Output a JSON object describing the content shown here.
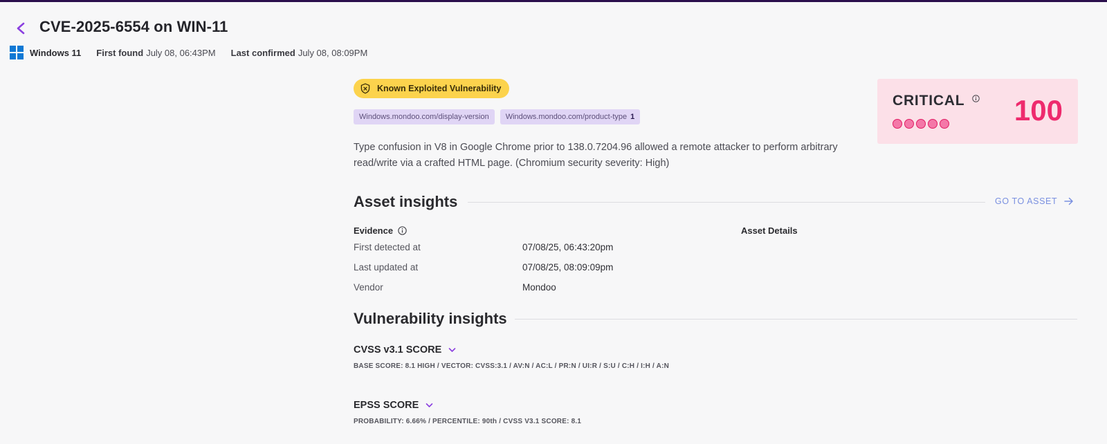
{
  "header": {
    "title": "CVE-2025-6554 on WIN-11",
    "os": "Windows 11",
    "first_found_label": "First found",
    "first_found_value": "July 08, 06:43PM",
    "last_confirmed_label": "Last confirmed",
    "last_confirmed_value": "July 08, 08:09PM"
  },
  "badge": {
    "label": "Known Exploited Vulnerability",
    "color": "#fcd34d"
  },
  "tags": [
    {
      "label": "Windows.mondoo.com/display-version",
      "count": ""
    },
    {
      "label": "Windows.mondoo.com/product-type",
      "count": "1"
    }
  ],
  "description": "Type confusion in V8 in Google Chrome prior to 138.0.7204.96 allowed a remote attacker to perform arbitrary read/write via a crafted HTML page. (Chromium security severity: High)",
  "score": {
    "severity": "CRITICAL",
    "value": "100",
    "dots": 5,
    "accent": "#ee2a6d",
    "background": "#fce0e8"
  },
  "asset_insights": {
    "title": "Asset insights",
    "go_to_asset": "GO TO ASSET",
    "evidence_label": "Evidence",
    "asset_details_label": "Asset Details",
    "rows": [
      {
        "label": "First detected at",
        "value": "07/08/25, 06:43:20pm"
      },
      {
        "label": "Last updated at",
        "value": "07/08/25, 08:09:09pm"
      },
      {
        "label": "Vendor",
        "value": "Mondoo"
      }
    ]
  },
  "vulnerability_insights": {
    "title": "Vulnerability insights",
    "cvss": {
      "label": "CVSS v3.1 SCORE",
      "detail": "BASE SCORE: 8.1 HIGH / VECTOR: CVSS:3.1 / AV:N / AC:L / PR:N / UI:R / S:U / C:H / I:H / A:N"
    },
    "epss": {
      "label": "EPSS SCORE",
      "detail": "PROBABILITY: 6.66% / PERCENTILE: 90th / CVSS V3.1 SCORE: 8.1"
    }
  }
}
